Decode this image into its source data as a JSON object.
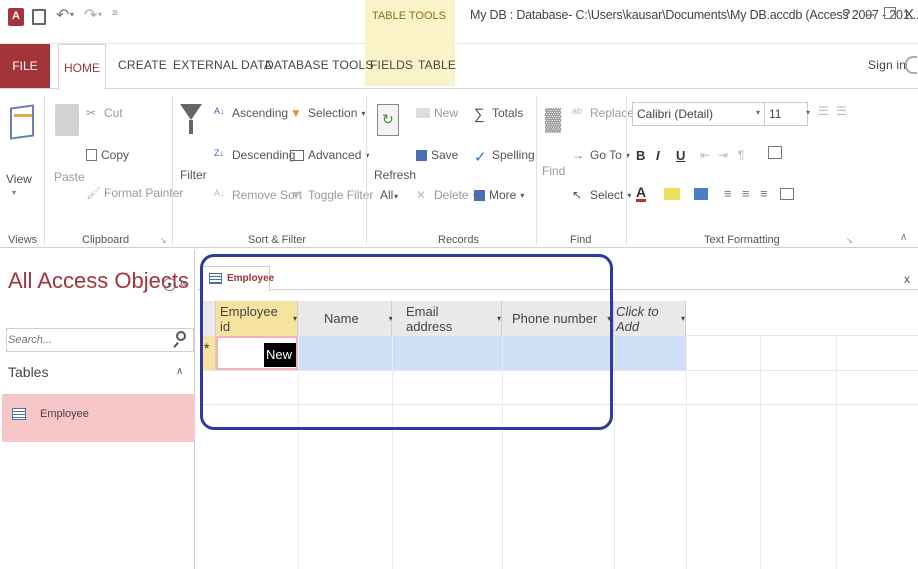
{
  "window": {
    "title": "My DB : Database- C:\\Users\\kausar\\Documents\\My DB.accdb (Access 2007 - 201...",
    "help": "?",
    "minimize": "–",
    "restore": "ร",
    "close": "X",
    "context_tab_group": "TABLE TOOLS"
  },
  "tabs": [
    "FILE",
    "HOME",
    "CREATE",
    "EXTERNAL DATA",
    "DATABASE TOOLS",
    "FIELDS",
    "TABLE"
  ],
  "sign_in": "Sign in",
  "ribbon": {
    "views": {
      "label": "Views",
      "view": "View"
    },
    "clipboard": {
      "label": "Clipboard",
      "paste": "Paste",
      "cut": "Cut",
      "copy": "Copy",
      "format_painter": "Format Painter"
    },
    "sort_filter": {
      "label": "Sort & Filter",
      "filter": "Filter",
      "ascending": "Ascending",
      "descending": "Descending",
      "remove_sort": "Remove Sort",
      "selection": "Selection",
      "advanced": "Advanced",
      "toggle_filter": "Toggle Filter"
    },
    "records": {
      "label": "Records",
      "refresh": "Refresh",
      "refresh_all": "All",
      "new": "New",
      "save": "Save",
      "delete": "Delete",
      "totals": "Totals",
      "spelling": "Spelling",
      "more": "More"
    },
    "find": {
      "label": "Find",
      "find": "Find",
      "replace": "Replace",
      "goto": "Go To",
      "select": "Select"
    },
    "text_formatting": {
      "label": "Text Formatting",
      "font": "Calibri (Detail)",
      "size": "11",
      "bold": "B",
      "italic": "I",
      "underline": "U"
    }
  },
  "nav": {
    "title": "All Access Objects",
    "search_placeholder": "Search...",
    "section": "Tables",
    "items": [
      "Employee"
    ]
  },
  "document": {
    "tab": "Employee",
    "close": "x",
    "columns": [
      "Employee id",
      "Name",
      "Email address",
      "Phone number",
      "Click to Add"
    ],
    "new_row_marker": "*",
    "new_value": "New"
  },
  "colors": {
    "accent": "#a3343a",
    "highlight_border": "#2e3a9c",
    "selected_row": "#cfe0f6",
    "context_tab": "#fbf3c8"
  }
}
